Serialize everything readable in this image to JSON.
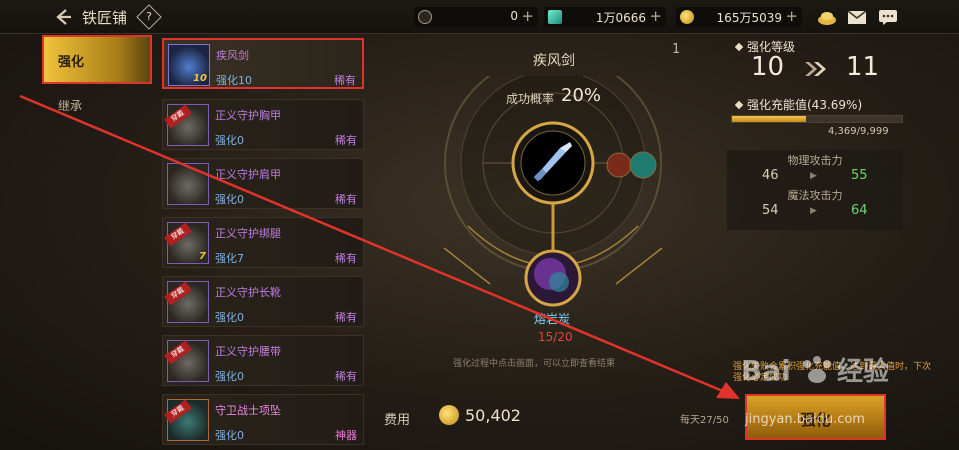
{
  "header": {
    "title": "铁匠铺",
    "help_label": "?",
    "currencies": [
      {
        "icon": "c-coin-icon",
        "value": "0"
      },
      {
        "icon": "gem-icon",
        "value": "1万0666"
      },
      {
        "icon": "gold-coin-icon",
        "value": "165万5039"
      }
    ]
  },
  "tabs": [
    {
      "label": "强化",
      "active": true
    },
    {
      "label": "继承",
      "active": false
    }
  ],
  "equipment": [
    {
      "name": "疾风剑",
      "level_badge": "10",
      "state": "强化10",
      "rarity": "稀有",
      "selected": true,
      "worn": false
    },
    {
      "name": "正义守护胸甲",
      "level_badge": "",
      "state": "强化0",
      "rarity": "稀有",
      "selected": false,
      "worn": true
    },
    {
      "name": "正义守护肩甲",
      "level_badge": "",
      "state": "强化0",
      "rarity": "稀有",
      "selected": false,
      "worn": false
    },
    {
      "name": "正义守护绑腿",
      "level_badge": "7",
      "state": "强化7",
      "rarity": "稀有",
      "selected": false,
      "worn": true
    },
    {
      "name": "正义守护长靴",
      "level_badge": "",
      "state": "强化0",
      "rarity": "稀有",
      "selected": false,
      "worn": true
    },
    {
      "name": "正义守护腰带",
      "level_badge": "",
      "state": "强化0",
      "rarity": "稀有",
      "selected": false,
      "worn": true
    },
    {
      "name": "守卫战士项坠",
      "level_badge": "",
      "state": "强化0",
      "rarity": "神器",
      "selected": false,
      "worn": true
    }
  ],
  "worn_tag": "穿戴",
  "center": {
    "item_name": "疾风剑",
    "page_mark": "1",
    "success_label": "成功概率",
    "success_rate": "20%",
    "material_name": "熔岩炭",
    "material_count": "15/20",
    "hint": "强化过程中点击画面，可以立即查看结果",
    "fee_label": "费用",
    "fee_value": "50,402",
    "daily_limit": "每天27/50"
  },
  "right": {
    "level_label": "强化等级",
    "level_from": "10",
    "level_to": "11",
    "charge_label": "强化充能值(43.69%)",
    "charge_fraction": 0.4369,
    "charge_value": "4,369/9,999",
    "stats": [
      {
        "name": "物理攻击力",
        "from": "46",
        "to": "55"
      },
      {
        "name": "魔法攻击力",
        "from": "54",
        "to": "64"
      }
    ],
    "warning": "强化失败会累积强化充能值，达到最大值时，下次强化必定成功",
    "button_label": "强化"
  },
  "watermark": {
    "logo": "Bai 经验",
    "site": "jingyan.baidu.com"
  },
  "colors": {
    "accent": "#e0332c",
    "gold": "#d9a227",
    "rare": "#c07ee0",
    "artifact": "#e87ad9",
    "success": "#6bd66f"
  }
}
